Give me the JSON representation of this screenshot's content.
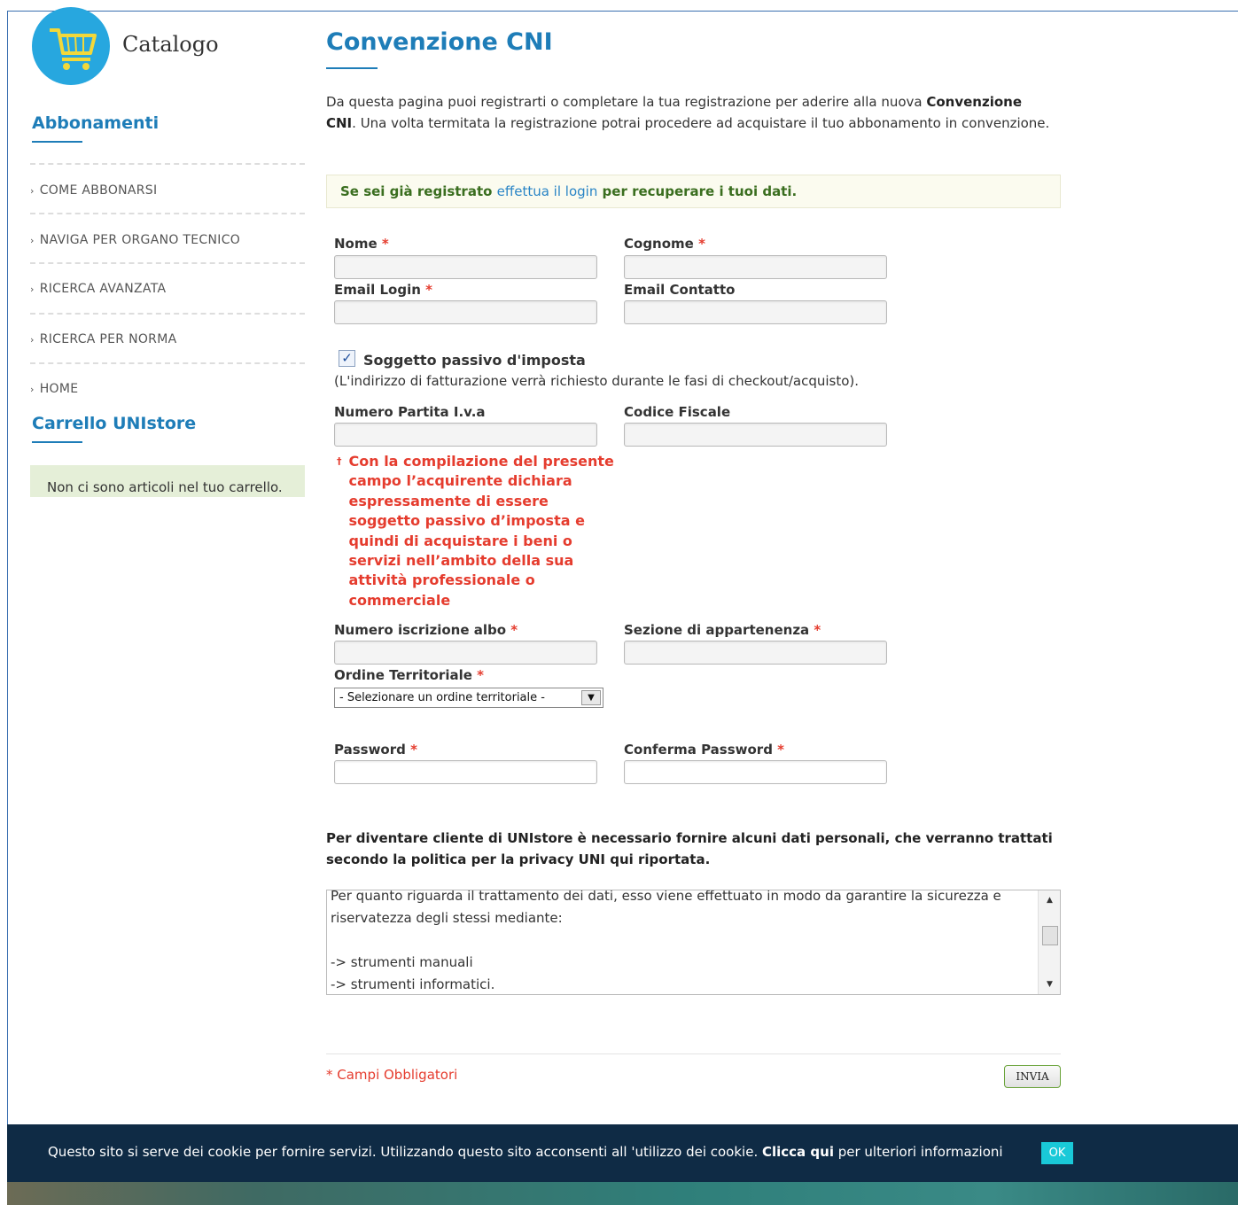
{
  "sidebar": {
    "logo_text": "Catalogo",
    "section_title": "Abbonamenti",
    "items": [
      {
        "label": "COME ABBONARSI"
      },
      {
        "label": "NAVIGA PER ORGANO TECNICO"
      },
      {
        "label": "RICERCA AVANZATA"
      },
      {
        "label": "RICERCA PER NORMA"
      },
      {
        "label": "HOME"
      }
    ],
    "cart_title": "Carrello UNIstore",
    "cart_empty": "Non ci sono articoli nel tuo carrello."
  },
  "main": {
    "title": "Convenzione CNI",
    "intro_part1": "Da questa pagina puoi registrarti o completare la tua registrazione per aderire alla nuova ",
    "intro_bold1": "Convenzione CNI",
    "intro_part2": ". Una volta termitata la registrazione potrai procedere ad acquistare il tuo abbonamento in convenzione.",
    "notice_before": "Se sei già registrato ",
    "notice_link": "effettua il login",
    "notice_after": " per recuperare i tuoi dati."
  },
  "form": {
    "required_mark": "*",
    "nome_label": "Nome",
    "cognome_label": "Cognome",
    "email_login_label": "Email Login",
    "email_contatto_label": "Email Contatto",
    "soggetto_label": "Soggetto passivo d'imposta",
    "soggetto_checked": true,
    "soggetto_note": "(L'indirizzo di fatturazione verrà richiesto durante le fasi di checkout/acquisto).",
    "piva_label": "Numero Partita I.v.a",
    "codice_fiscale_label": "Codice Fiscale",
    "piva_warning": "Con la compilazione del presente campo l’acquirente dichiara espressamente di essere soggetto passivo d’imposta e quindi di acquistare i beni o servizi nell’ambito della sua attività professionale o commerciale",
    "warning_mark": "†",
    "iscrizione_label": "Numero iscrizione albo",
    "sezione_label": "Sezione di appartenenza",
    "ordine_label": "Ordine Territoriale",
    "ordine_selected": "- Selezionare un ordine territoriale -",
    "password_label": "Password",
    "conferma_label": "Conferma Password"
  },
  "privacy": {
    "intro": "Per diventare cliente di UNIstore è necessario fornire alcuni dati personali, che verranno trattati secondo la politica per la privacy UNI qui riportata.",
    "lines": [
      "Per quanto riguarda il trattamento dei dati, esso viene effettuato in modo da garantire la sicurezza e riservatezza degli stessi mediante:",
      "",
      "->  strumenti manuali",
      "->  strumenti informatici."
    ]
  },
  "footer": {
    "mandatory_note": "* Campi Obbligatori",
    "send_label": "INVIA"
  },
  "cookie": {
    "text_before": "Questo sito si serve dei cookie per fornire servizi. Utilizzando questo sito acconsenti all 'utilizzo dei cookie. ",
    "link": "Clicca qui",
    "text_after": " per ulteriori informazioni",
    "ok_label": "OK"
  },
  "colors": {
    "brand_blue": "#1e7db8",
    "required_red": "#e53c2e",
    "cookie_bg": "#0f2b45",
    "cookie_ok": "#19c9d8"
  }
}
